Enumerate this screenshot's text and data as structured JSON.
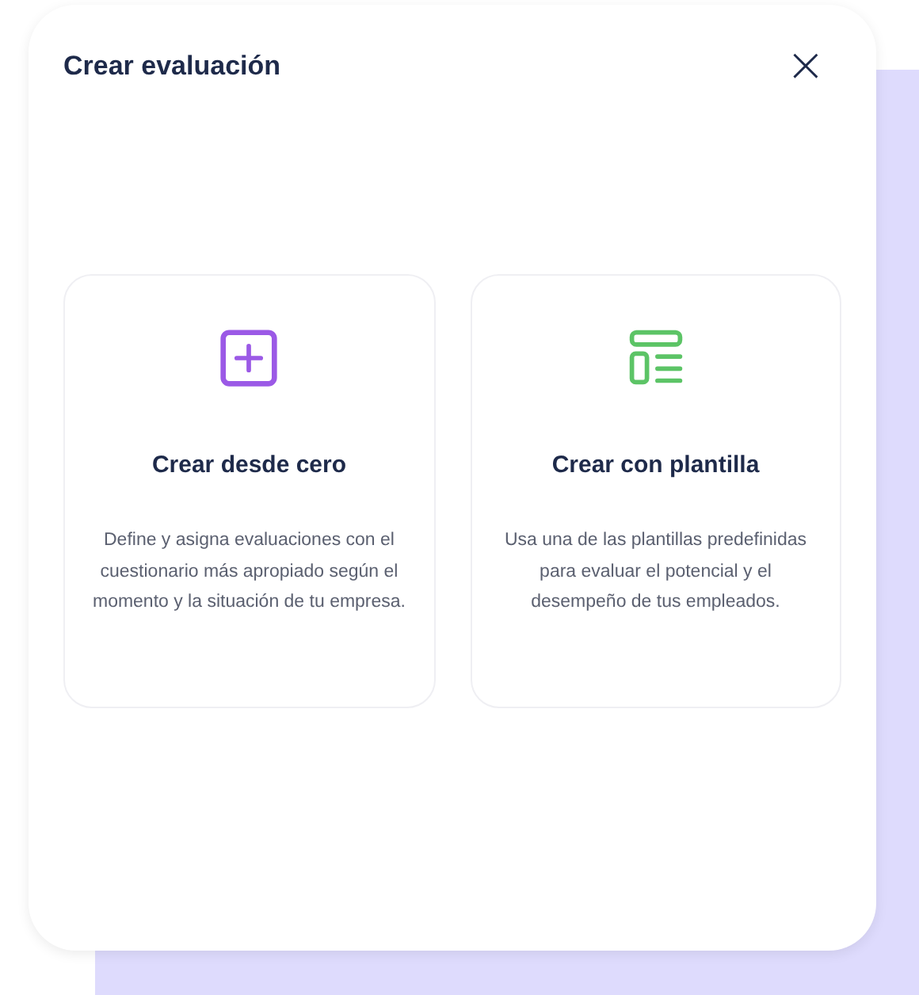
{
  "dialog": {
    "title": "Crear evaluación",
    "close": "×"
  },
  "options": [
    {
      "kind": "blank",
      "color": "#9b59e6",
      "title": "Crear desde cero",
      "description": "Define y asigna evaluaciones con el cuestionario más apropiado según el momento y la situación de tu empresa."
    },
    {
      "kind": "template",
      "color": "#5cc466",
      "title": "Crear con plantilla",
      "description": "Usa una de las plantillas predefinidas para evaluar el potencial y el desempeño de tus empleados."
    }
  ]
}
